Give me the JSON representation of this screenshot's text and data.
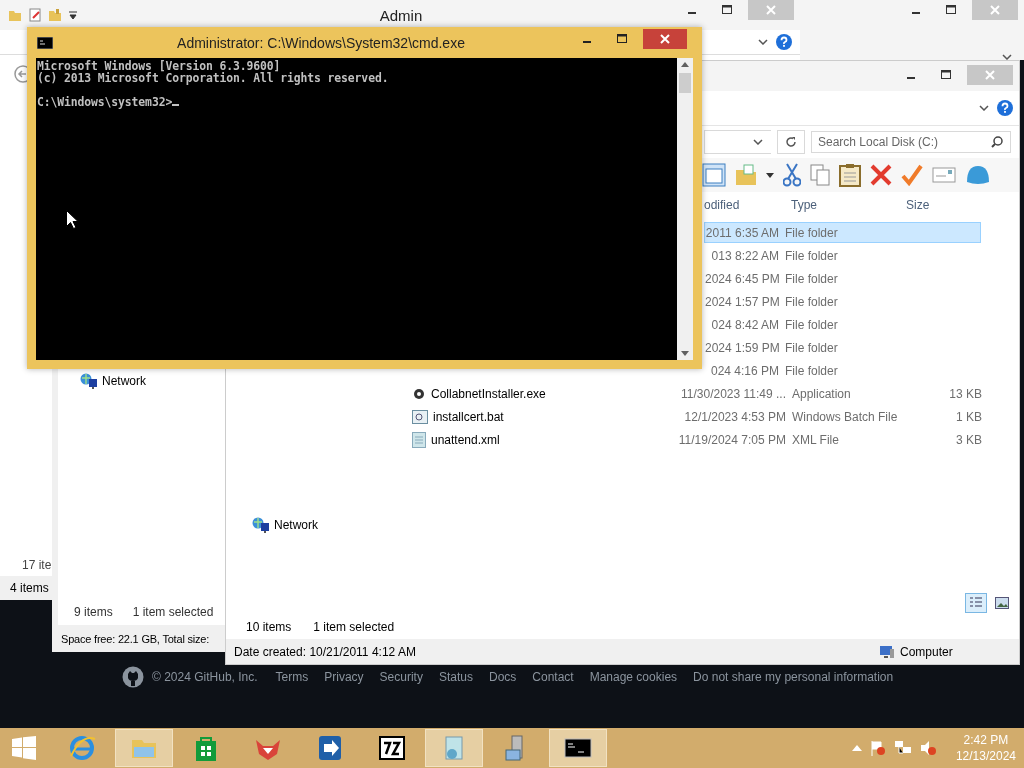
{
  "back_window": {
    "title": "Admin",
    "partial_count": "17 ite",
    "status": "4 items"
  },
  "middle_window": {
    "nav_items": [
      {
        "label": "Network"
      }
    ],
    "status_items": "9 items",
    "status_selected": "1 item selected",
    "space": "Space free: 22.1 GB, Total size:"
  },
  "explorer": {
    "search": {
      "placeholder": "Search Local Disk (C:)"
    },
    "columns": [
      "odified",
      "Type",
      "Size"
    ],
    "rows": [
      {
        "date": "2011 6:35 AM",
        "type": "File folder",
        "selected": true
      },
      {
        "date": "013 8:22 AM",
        "type": "File folder",
        "selected": false
      },
      {
        "date": "2024 6:45 PM",
        "type": "File folder",
        "selected": false
      },
      {
        "date": "2024 1:57 PM",
        "type": "File folder",
        "selected": false
      },
      {
        "date": "024 8:42 AM",
        "type": "File folder",
        "selected": false
      },
      {
        "date": "2024 1:59 PM",
        "type": "File folder",
        "selected": false
      },
      {
        "date": "024 4:16 PM",
        "type": "File folder",
        "selected": false
      },
      {
        "name": "CollabnetInstaller.exe",
        "kind": "app",
        "date": "11/30/2023 11:49 ...",
        "type": "Application",
        "size": "13 KB",
        "selected": false
      },
      {
        "name": "installcert.bat",
        "kind": "batch",
        "date": "12/1/2023 4:53 PM",
        "type": "Windows Batch File",
        "size": "1 KB",
        "selected": false
      },
      {
        "name": "unattend.xml",
        "kind": "xml",
        "date": "11/19/2024 7:05 PM",
        "type": "XML File",
        "size": "3 KB",
        "selected": false
      }
    ],
    "nav_items": [
      {
        "label": "Network"
      }
    ],
    "status_items": "10 items",
    "status_selected": "1 item selected",
    "details": "Date created: 10/21/2011 4:12 AM",
    "location": "Computer",
    "view_buttons": [
      {
        "kind": "details",
        "selected": true
      },
      {
        "kind": "thumbnails",
        "selected": false
      }
    ]
  },
  "cmd": {
    "title": "Administrator: C:\\Windows\\System32\\cmd.exe",
    "output": [
      "Microsoft Windows [Version 6.3.9600]",
      "(c) 2013 Microsoft Corporation. All rights reserved."
    ],
    "prompt": "C:\\Windows\\system32>"
  },
  "footer": {
    "copyright": "© 2024 GitHub, Inc.",
    "links": [
      "Terms",
      "Privacy",
      "Security",
      "Status",
      "Docs",
      "Contact",
      "Manage cookies",
      "Do not share my personal information"
    ]
  },
  "taskbar": {
    "apps": [
      {
        "kind": "ie",
        "running": false
      },
      {
        "kind": "explorer",
        "running": true
      },
      {
        "kind": "store",
        "running": false
      },
      {
        "kind": "red",
        "running": false
      },
      {
        "kind": "arrow",
        "running": false
      },
      {
        "kind": "archive",
        "running": false
      },
      {
        "kind": "image",
        "running": true
      },
      {
        "kind": "server",
        "running": false
      },
      {
        "kind": "cmd",
        "running": true
      }
    ],
    "time": "2:42 PM",
    "date": "12/13/2024"
  }
}
